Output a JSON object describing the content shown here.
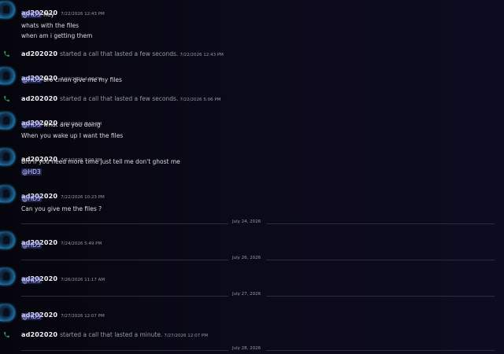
{
  "user": "ad202020",
  "messages": [
    {
      "ts": "7/22/2026 12:43 PM",
      "mention": "@HD3",
      "after_mention": "hey",
      "lines": [
        "whats with the files",
        "when am i getting them"
      ]
    },
    {
      "ts": "7/22/2026 4:38 PM",
      "mention": "@HD3",
      "after_mention": "bro cmon give me my files",
      "lines": []
    },
    {
      "ts": "7/22/2026 5:12 PM",
      "mention": "@HD3",
      "after_mention": "what are you doing",
      "lines": [
        "When you wake up I want the files"
      ]
    },
    {
      "ts": "7/22/2026 7:28 PM",
      "text": "Bro if you need more time just tell me don't ghost me",
      "mention_line": "@HD3"
    },
    {
      "ts": "7/22/2026 10:23 PM",
      "mention_line": "@HD3",
      "text_after": "Can you give me the files ?"
    },
    {
      "ts": "7/24/2026 5:49 PM",
      "mention_line": "@HD3"
    },
    {
      "ts": "7/26/2026 11:17 AM",
      "mention_line": "@HD3"
    },
    {
      "ts": "7/27/2026 12:07 PM",
      "mention_line": "@HD3"
    }
  ],
  "calls": [
    {
      "text": "started a call that lasted a few seconds.",
      "ts": "7/22/2026 12:43 PM"
    },
    {
      "text": "started a call that lasted a few seconds.",
      "ts": "7/22/2026 5:06 PM"
    },
    {
      "text": "started a call that lasted a minute.",
      "ts": "7/27/2026 12:07 PM"
    }
  ],
  "dividers": [
    "July 24, 2026",
    "July 26, 2026",
    "July 27, 2026",
    "July 28, 2026"
  ],
  "colors": {
    "call_icon": "#23a55a",
    "mention_bg": "#5865f2",
    "avatar_ring": "#2bb3e6"
  }
}
